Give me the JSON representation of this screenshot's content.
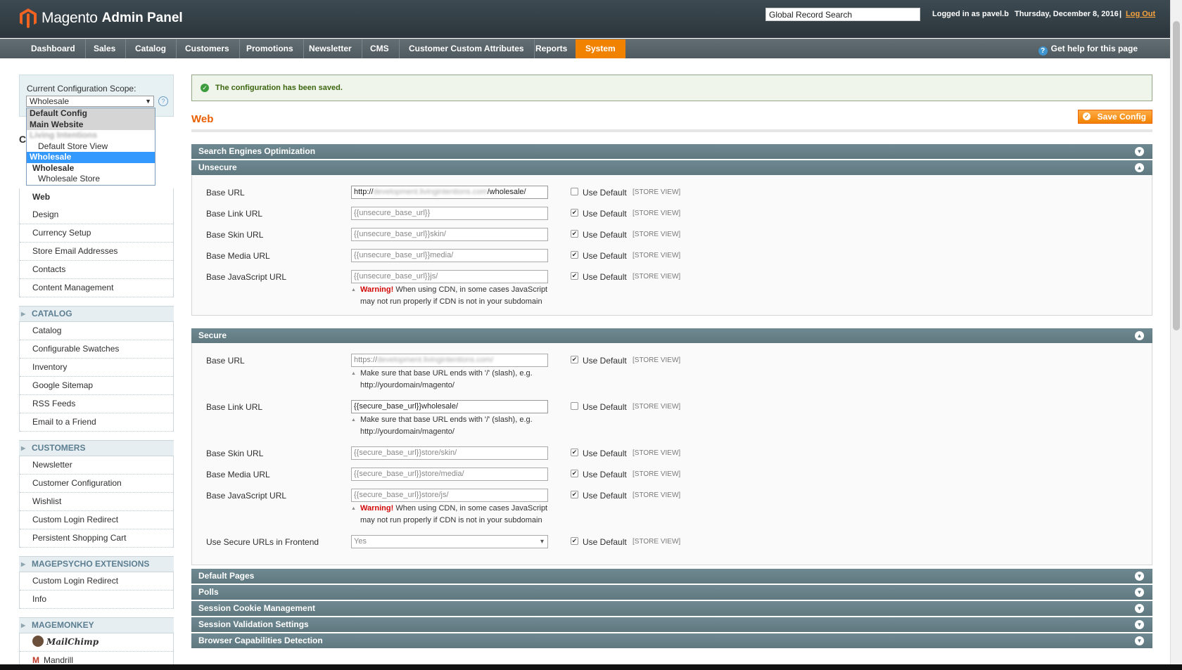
{
  "header": {
    "brand": "Magento",
    "brand_suffix": "Admin Panel",
    "search_value": "Global Record Search",
    "logged_in": "Logged in as pavel.b",
    "date": "Thursday, December 8, 2016",
    "separator": "|",
    "logout": "Log Out"
  },
  "nav": {
    "items": [
      "Dashboard",
      "Sales",
      "Catalog",
      "Customers",
      "Promotions",
      "Newsletter",
      "CMS",
      "Customer Custom Attributes",
      "Reports",
      "System"
    ],
    "active": "System",
    "help": "Get help for this page"
  },
  "sidebar": {
    "scope_label": "Current Configuration Scope:",
    "scope_value": "Wholesale",
    "dropdown": [
      "Default Config",
      "Main Website",
      "Living Intentions",
      "Default Store View",
      "Wholesale",
      "Wholesale",
      "Wholesale Store"
    ],
    "heading_partial": "C",
    "general_items": [
      "Web",
      "Design",
      "Currency Setup",
      "Store Email Addresses",
      "Contacts",
      "Content Management"
    ],
    "catalog_title": "CATALOG",
    "catalog_items": [
      "Catalog",
      "Configurable Swatches",
      "Inventory",
      "Google Sitemap",
      "RSS Feeds",
      "Email to a Friend"
    ],
    "customers_title": "CUSTOMERS",
    "customers_items": [
      "Newsletter",
      "Customer Configuration",
      "Wishlist",
      "Custom Login Redirect",
      "Persistent Shopping Cart"
    ],
    "magepsycho_title": "MAGEPSYCHO EXTENSIONS",
    "magepsycho_items": [
      "Custom Login Redirect",
      "Info"
    ],
    "magemonkey_title": "MAGEMONKEY",
    "magemonkey_items": [
      "MailChimp",
      "Mandrill"
    ]
  },
  "main": {
    "message": "The configuration has been saved.",
    "title": "Web",
    "save": "Save Config",
    "sections": {
      "seo": "Search Engines Optimization",
      "unsecure": "Unsecure",
      "secure": "Secure",
      "default_pages": "Default Pages",
      "polls": "Polls",
      "session_cookie": "Session Cookie Management",
      "session_validation": "Session Validation Settings",
      "browser": "Browser Capabilities Detection"
    },
    "use_default": "Use Default",
    "store_view": "[STORE VIEW]",
    "unsecure_rows": [
      {
        "label": "Base URL",
        "value_prefix": "http://",
        "value_blur": "development.livingintentions.com",
        "value_suffix": "/wholesale/",
        "checked": false
      },
      {
        "label": "Base Link URL",
        "value": "{{unsecure_base_url}}",
        "checked": true
      },
      {
        "label": "Base Skin URL",
        "value": "{{unsecure_base_url}}skin/",
        "checked": true
      },
      {
        "label": "Base Media URL",
        "value": "{{unsecure_base_url}}media/",
        "checked": true
      },
      {
        "label": "Base JavaScript URL",
        "value": "{{unsecure_base_url}}js/",
        "checked": true
      }
    ],
    "warning_label": "Warning!",
    "warning_text": "When using CDN, in some cases JavaScript",
    "warning_text2": "may not run properly if CDN is not in your subdomain",
    "slash_note": "Make sure that base URL ends with '/' (slash), e.g.",
    "slash_example": "http://yourdomain/magento/",
    "secure_rows": [
      {
        "label": "Base URL",
        "value_prefix": "https://",
        "value_blur": "development.livingintentions.com/",
        "checked": true
      },
      {
        "label": "Base Link URL",
        "value": "{{secure_base_url}}wholesale/",
        "checked": false
      },
      {
        "label": "Base Skin URL",
        "value": "{{secure_base_url}}store/skin/",
        "checked": true
      },
      {
        "label": "Base Media URL",
        "value": "{{secure_base_url}}store/media/",
        "checked": true
      },
      {
        "label": "Base JavaScript URL",
        "value": "{{secure_base_url}}store/js/",
        "checked": true
      },
      {
        "label": "Use Secure URLs in Frontend",
        "value": "Yes",
        "checked": true
      }
    ]
  },
  "colors": {
    "accent": "#f18200",
    "section_header": "#5f7880",
    "page_title": "#eb5e00"
  }
}
